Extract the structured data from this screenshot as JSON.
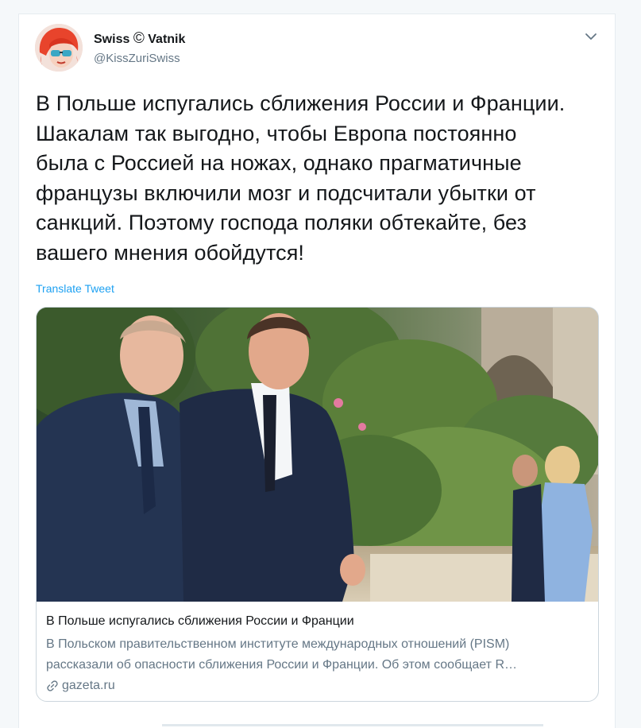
{
  "tweet": {
    "author_name_part1": "Swiss",
    "author_name_symbol": "©",
    "author_name_part2": "Vatnik",
    "handle": "@KissZuriSwiss",
    "text_lines": [
      "В Польше испугались сближения России и Франции.",
      "Шакалам так выгодно, чтобы Европа постоянно",
      "была с Россией на ножах, однако прагматичные",
      "французы включили мозг и подсчитали убытки от",
      "санкций. Поэтому господа поляки обтекайте, без",
      "вашего мнения обойдутся!"
    ],
    "translate_label": "Translate Tweet"
  },
  "preview": {
    "title": "В Польше испугались сближения России и Франции",
    "description_lines": [
      "В Польском правительственном институте международных отношений (PISM)",
      "рассказали об опасности сближения России и Франции. Об этом сообщает R…"
    ],
    "domain": "gazeta.ru"
  },
  "icons": {
    "menu": "chevron-down-icon",
    "link": "link-icon",
    "avatar": "avatar"
  },
  "colors": {
    "link": "#1da1f2",
    "secondary_text": "#657786",
    "border": "#ccd6dd"
  }
}
